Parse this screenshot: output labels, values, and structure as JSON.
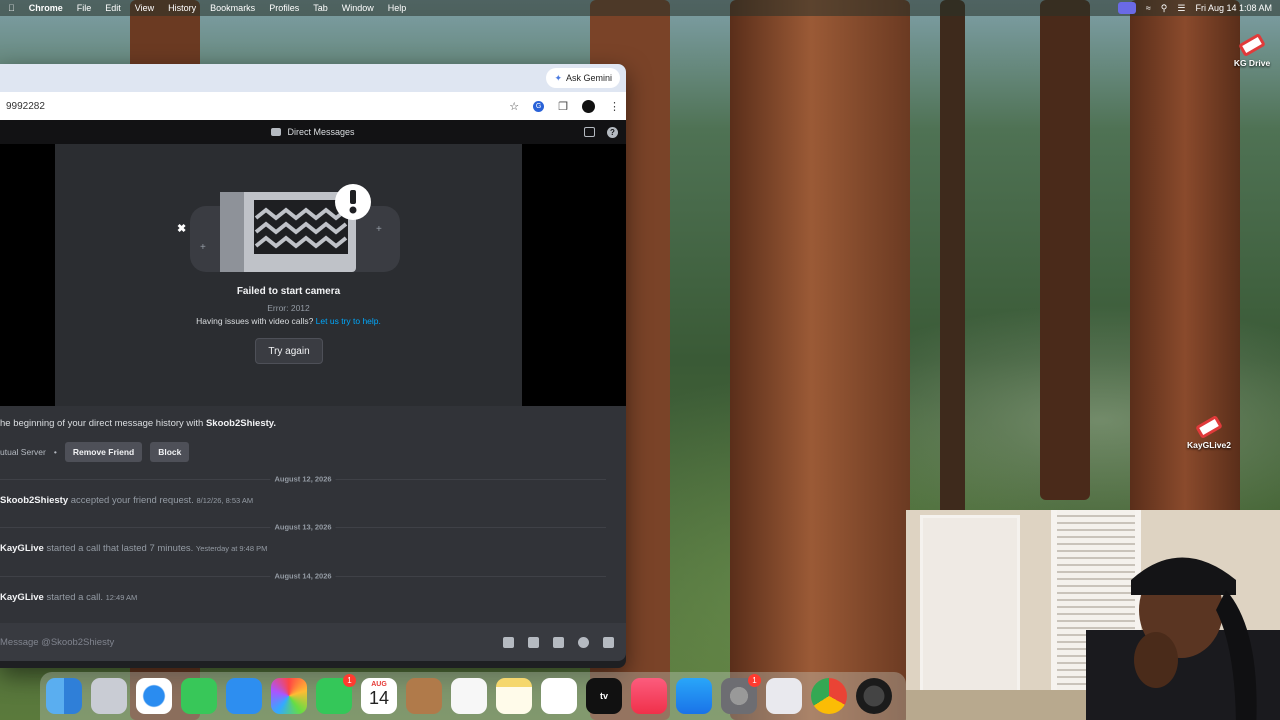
{
  "menubar": {
    "app_name": "Chrome",
    "items": [
      "File",
      "Edit",
      "View",
      "History",
      "Bookmarks",
      "Profiles",
      "Tab",
      "Window",
      "Help"
    ],
    "clock": "Fri Aug 14  1:08 AM"
  },
  "browser": {
    "ask_gemini": "Ask Gemini",
    "url_fragment": "9992282"
  },
  "discord": {
    "title": "Direct Messages",
    "call": {
      "error_title": "Failed to start camera",
      "error_code": "Error: 2012",
      "help_text": "Having issues with video calls?",
      "help_link": "Let us try to help.",
      "try_again": "Try again"
    },
    "intro_prefix": "he beginning of your direct message history with",
    "intro_user": "Skoob2Shiesty.",
    "mutual_server": "utual Server",
    "remove_friend": "Remove Friend",
    "block": "Block",
    "messages": [
      {
        "date": "August 12, 2026",
        "user": "Skoob2Shiesty",
        "text": "accepted your friend request.",
        "time": "8/12/26, 8:53 AM"
      },
      {
        "date": "August 13, 2026",
        "user": "KayGLive",
        "text": "started a call that lasted 7 minutes.",
        "time": "Yesterday at 9:48 PM"
      },
      {
        "date": "August 14, 2026",
        "user": "KayGLive",
        "text": "started a call.",
        "time": "12:49 AM"
      }
    ],
    "composer_placeholder": "Message @Skoob2Shiesty"
  },
  "desktop_icons": [
    {
      "label": "KG Drive"
    },
    {
      "label": "KayGLive2"
    }
  ],
  "dock": {
    "facetime_badge": "1",
    "calendar_month": "AUG",
    "calendar_day": "14",
    "settings_badge": "1",
    "tv_label": "tv"
  }
}
